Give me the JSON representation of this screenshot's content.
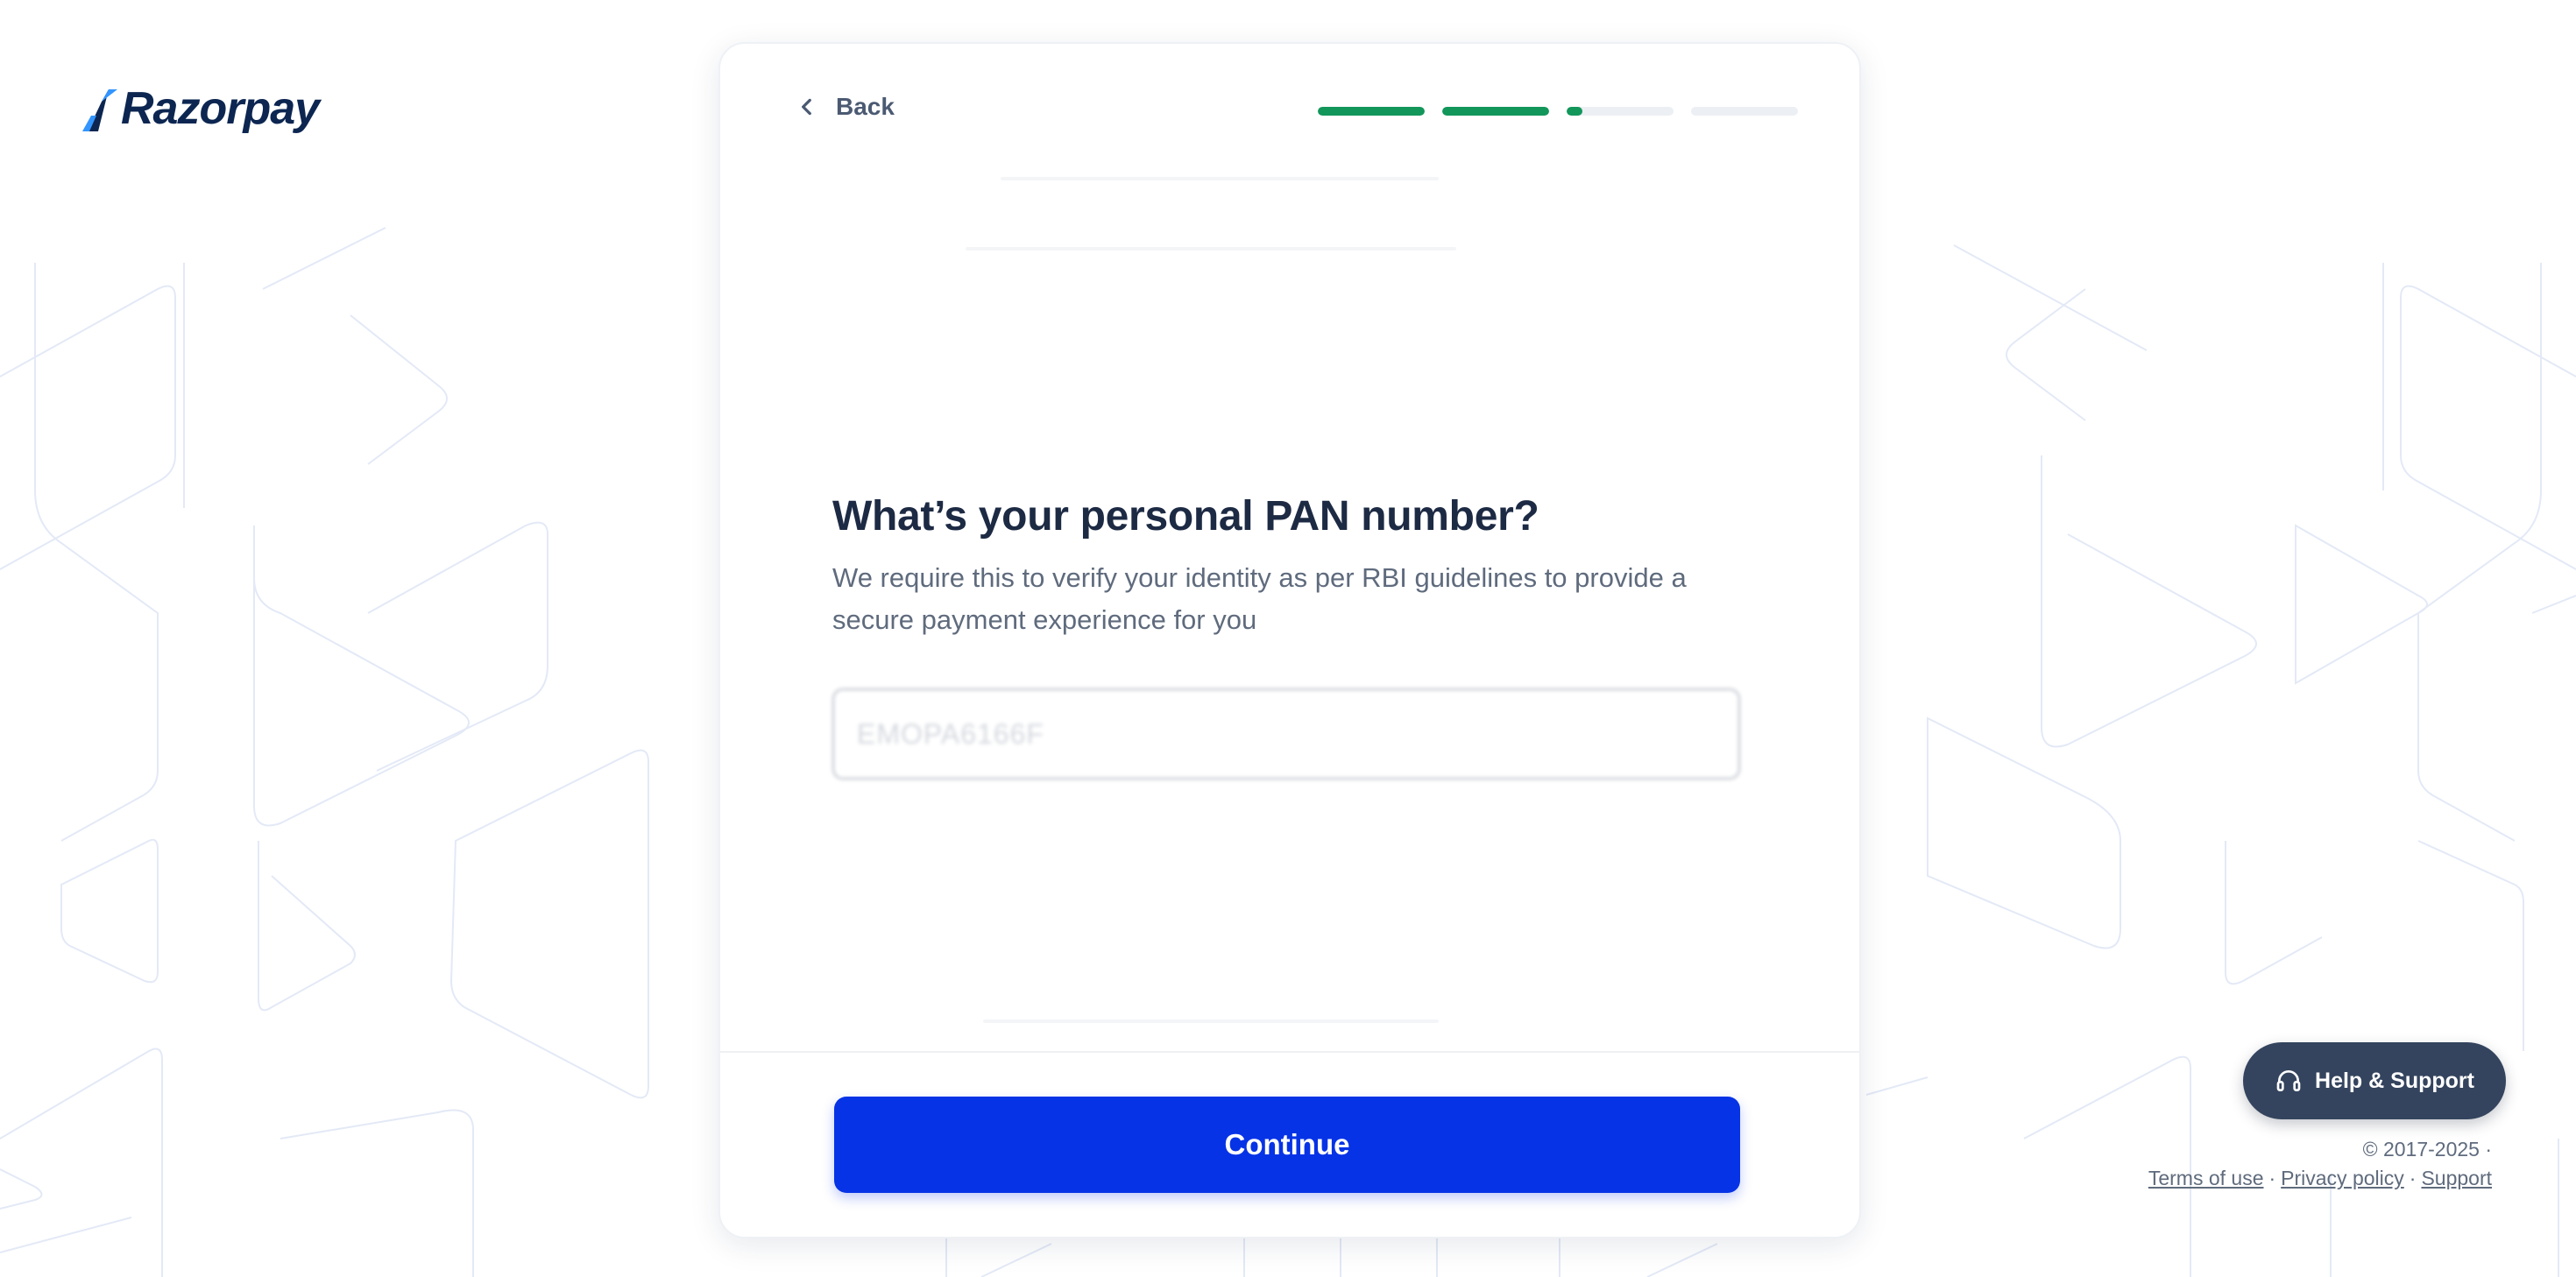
{
  "brand": {
    "name": "Razorpay",
    "mark_color": "#3395ff",
    "text_color": "#0c2651"
  },
  "header": {
    "back_label": "Back",
    "progress": [
      1,
      1,
      0.15,
      0
    ],
    "progress_color": "#12965a"
  },
  "form": {
    "title": "What’s your personal PAN number?",
    "subtitle": "We require this to verify your identity as per RBI guidelines to provide a secure payment experience for you",
    "pan_value": "EMOPA6166F",
    "submit_label": "Continue",
    "submit_color": "#0733e6"
  },
  "help": {
    "label": "Help & Support",
    "icon": "headphones-icon"
  },
  "footer": {
    "copyright": "© 2017-2025 ·",
    "links": [
      "Terms of use",
      "Privacy policy",
      "Support"
    ]
  }
}
